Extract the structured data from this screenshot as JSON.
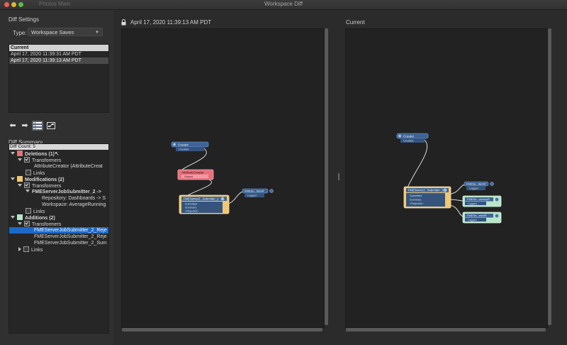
{
  "window": {
    "title": "Workspace Diff",
    "ghost_tabs": "Photos      Main"
  },
  "diff_settings": {
    "label": "Diff Settings",
    "type_label": "Type:",
    "type_value": "Workspace Saves",
    "saves": {
      "header": "Current",
      "items": [
        {
          "label": "April 17, 2020 11:39:31 AM PDT",
          "selected": false
        },
        {
          "label": "April 17, 2020 11:39:13 AM PDT",
          "selected": true
        }
      ]
    }
  },
  "toolbar": {
    "prev_icon": "arrow-left-icon",
    "next_icon": "arrow-right-icon",
    "list_icon": "list-view-icon",
    "graph_icon": "graph-view-icon"
  },
  "diff_summary": {
    "label": "Diff Summary",
    "count": "Diff Count: 5",
    "deletions": {
      "label": "Deletions (1)",
      "color": "#e8707c",
      "transformers_label": "Transformers",
      "items": [
        "AttributeCreator (AttributeCreat"
      ],
      "links_label": "Links"
    },
    "modifications": {
      "label": "Modifications (2)",
      "color": "#f0c874",
      "transformers_label": "Transformers",
      "group": "FMEServerJobSubmitter_2 ->",
      "details": [
        "Repository: Dashboards -> S",
        "Workspace: AverageRunning"
      ],
      "links_label": "Links"
    },
    "additions": {
      "label": "Additions (2)",
      "color": "#b8e6c8",
      "transformers_label": "Transformers",
      "items": [
        "FMEServerJobSubmitter_2_Reje",
        "FMEServerJobSubmitter_2_Reje",
        "FMEServerJobSubmitter_2_Sum"
      ],
      "links_label": "Links"
    }
  },
  "left_canvas": {
    "title": "April 17, 2020 11:39:13 AM PDT",
    "nodes": {
      "creator": {
        "title": "Creator",
        "ports": [
          "Created"
        ]
      },
      "attr": {
        "title": "AttributeCreator",
        "ports": [
          "Output"
        ]
      },
      "fme": {
        "title": "FMEServerJ...Submitter_2",
        "ports": [
          "Submitted",
          "Summary",
          "<Rejected>"
        ]
      },
      "logger": {
        "title": "FMESe...ItemR",
        "ports": [
          "Logged"
        ]
      }
    }
  },
  "right_canvas": {
    "title": "Current",
    "nodes": {
      "creator": {
        "title": "Creator",
        "ports": [
          "Created"
        ]
      },
      "fme": {
        "title": "FMEServerJ...Submitter_2",
        "ports": [
          "Submitted",
          "Summary",
          "<Rejected>"
        ]
      },
      "l1": {
        "title": "FMESe...ItemR",
        "ports": [
          "Logged"
        ]
      },
      "l2": {
        "title": "FMESe...mmaryR",
        "ports": [
          "Logged"
        ]
      },
      "l3": {
        "title": "FMESe...etedR",
        "ports": [
          "Logged"
        ]
      }
    }
  },
  "colors": {
    "deletion": "#e8707c",
    "modification": "#f0c874",
    "addition": "#b8e6c8",
    "node_blue": "#3f6494",
    "selection": "#1c69c9"
  }
}
